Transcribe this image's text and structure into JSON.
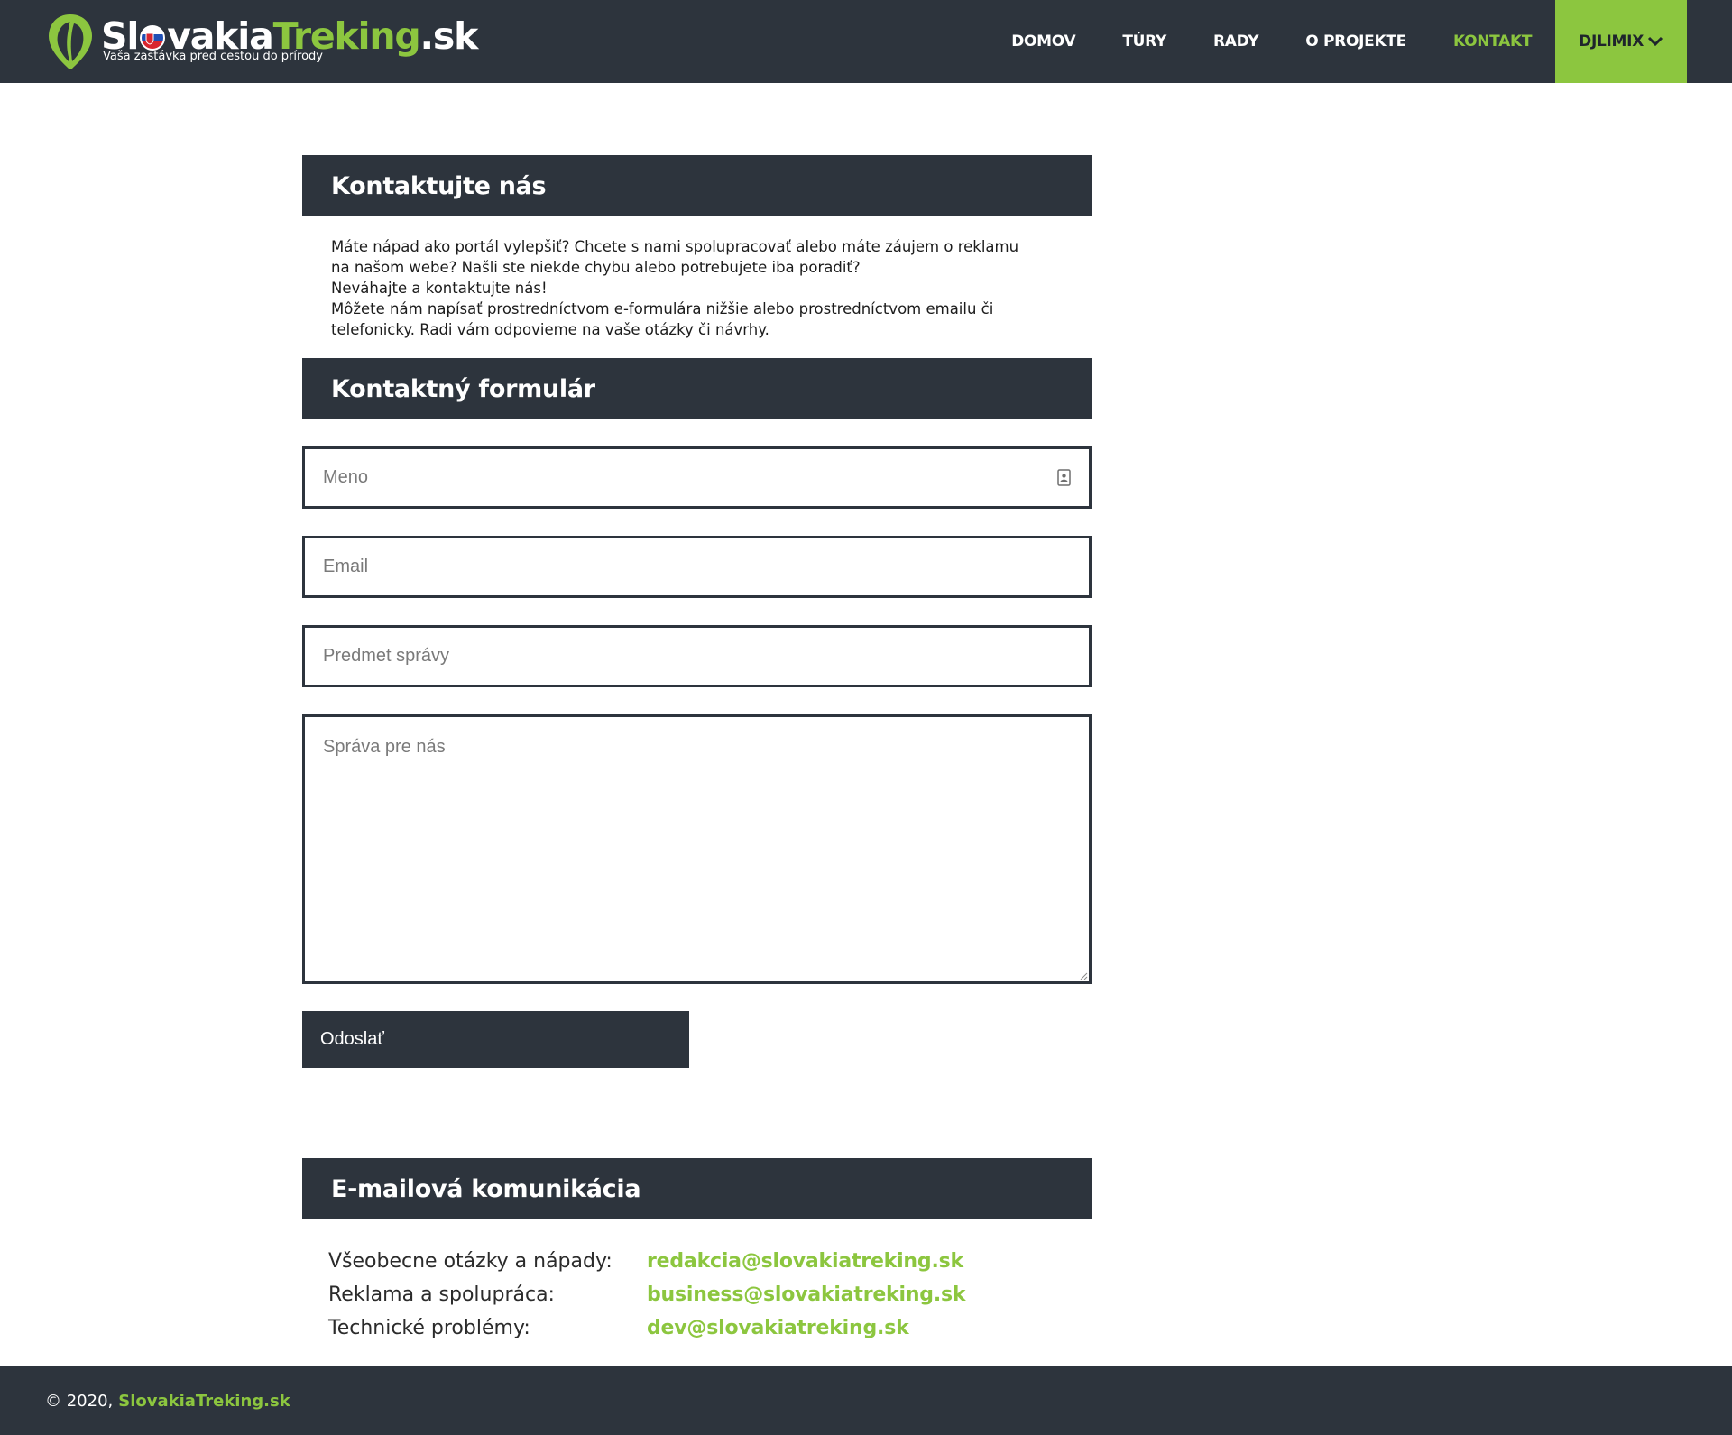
{
  "header": {
    "brand_part1": "Sl",
    "brand_part2": "vakia",
    "brand_part3": "Treking",
    "brand_part4": ".sk",
    "tagline": "Vaša zastávka pred cestou do prírody",
    "nav": [
      {
        "label": "DOMOV",
        "active": false
      },
      {
        "label": "TÚRY",
        "active": false
      },
      {
        "label": "RADY",
        "active": false
      },
      {
        "label": "O PROJEKTE",
        "active": false
      },
      {
        "label": "KONTAKT",
        "active": true
      }
    ],
    "user_label": "DJLIMIX"
  },
  "contact": {
    "title": "Kontaktujte nás",
    "intro_line1": "Máte nápad ako portál vylepšiť? Chcete s nami spolupracovať alebo máte záujem o reklamu na našom webe? Našli ste niekde chybu alebo potrebujete iba poradiť?",
    "intro_line2": "Neváhajte a kontaktujte nás!",
    "intro_line3": "Môžete nám napísať prostredníctvom e-formulára nižšie alebo prostredníctvom emailu či telefonicky. Radi vám odpovieme na vaše otázky či návrhy."
  },
  "form": {
    "title": "Kontaktný formulár",
    "name_placeholder": "Meno",
    "email_placeholder": "Email",
    "subject_placeholder": "Predmet správy",
    "message_placeholder": "Správa pre nás",
    "name_value": "",
    "email_value": "",
    "subject_value": "",
    "message_value": "",
    "submit_label": "Odoslať"
  },
  "emails": {
    "title": "E-mailová komunikácia",
    "rows": [
      {
        "label": "Všeobecne otázky a nápady:",
        "email": "redakcia@slovakiatreking.sk"
      },
      {
        "label": "Reklama a spolupráca:",
        "email": "business@slovakiatreking.sk"
      },
      {
        "label": "Technické problémy:",
        "email": "dev@slovakiatreking.sk"
      }
    ]
  },
  "footer": {
    "copyright": "© 2020,",
    "brand": "SlovakiaTreking.sk"
  },
  "colors": {
    "dark": "#2d343d",
    "accent": "#8cc63f",
    "white": "#ffffff"
  },
  "icons": {
    "logo": "leaf-pin-icon",
    "user_dropdown": "chevron-down-icon",
    "autofill": "contact-card-icon"
  }
}
